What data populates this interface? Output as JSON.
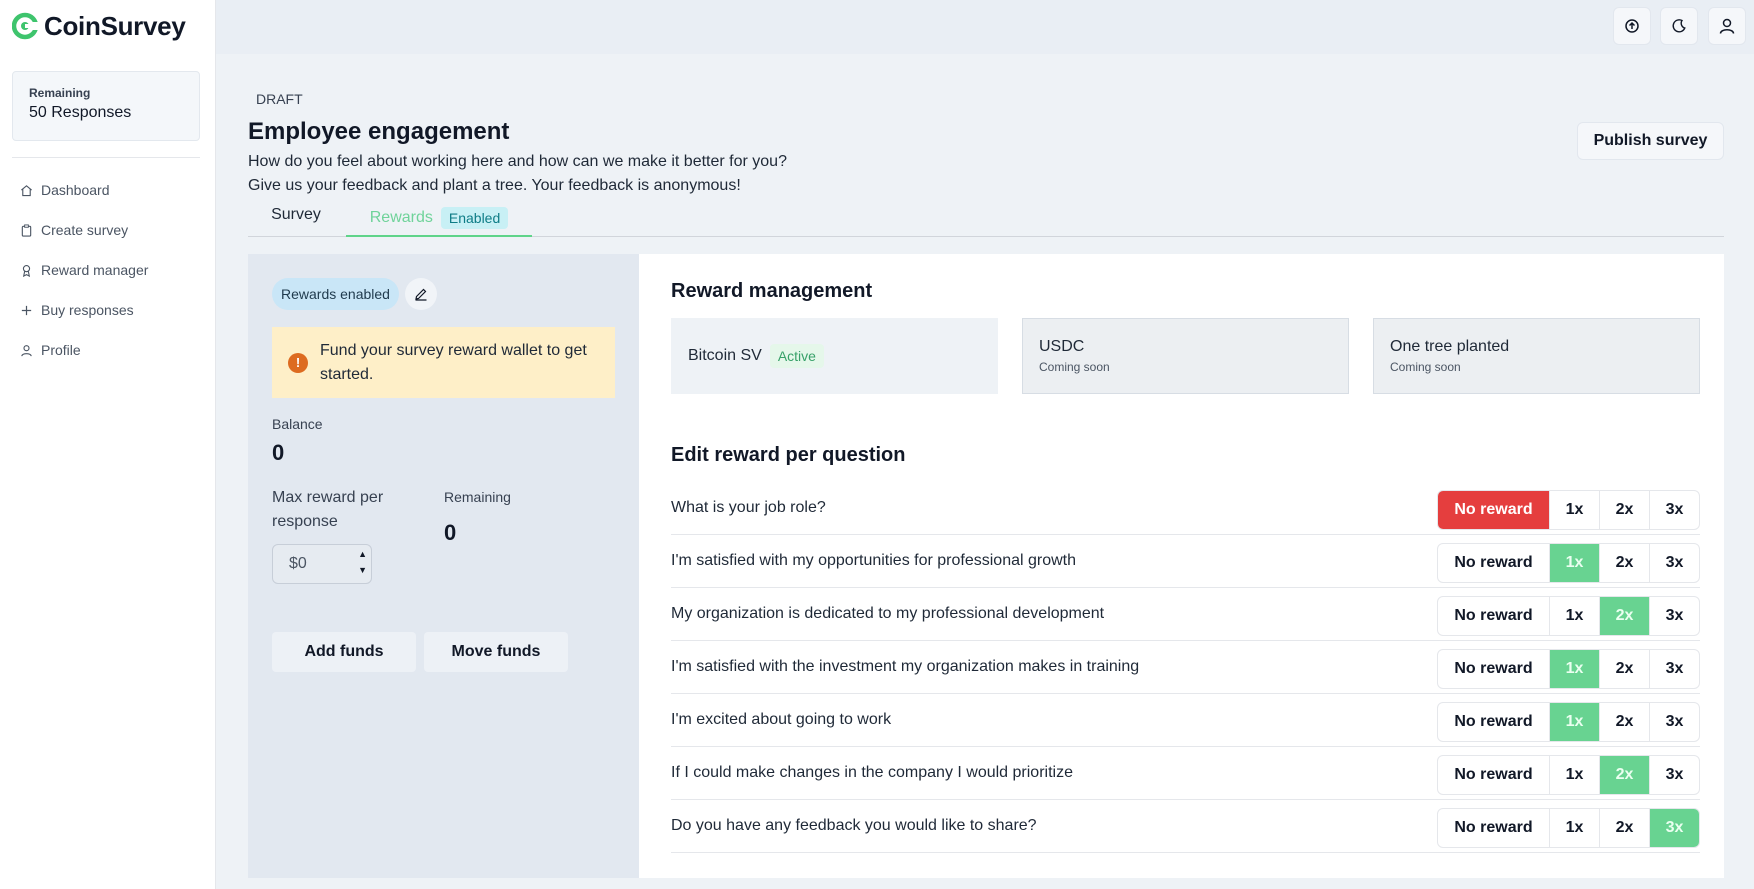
{
  "app": {
    "name": "CoinSurvey"
  },
  "sidebar": {
    "remaining_label": "Remaining",
    "remaining_value": "50 Responses",
    "items": [
      {
        "label": "Dashboard",
        "icon": "home-icon"
      },
      {
        "label": "Create survey",
        "icon": "clipboard-icon"
      },
      {
        "label": "Reward manager",
        "icon": "award-icon"
      },
      {
        "label": "Buy responses",
        "icon": "plus-icon"
      },
      {
        "label": "Profile",
        "icon": "user-icon"
      }
    ]
  },
  "topbar": {
    "icons": [
      "upload-icon",
      "moon-icon",
      "user-icon"
    ]
  },
  "header": {
    "status": "DRAFT",
    "title": "Employee engagement",
    "subtitle_line1": "How do you feel about working here and how can we make it better for you?",
    "subtitle_line2": "Give us your feedback and plant a tree. Your feedback is anonymous!",
    "publish_label": "Publish survey"
  },
  "tabs": {
    "survey": "Survey",
    "rewards": "Rewards",
    "rewards_badge": "Enabled"
  },
  "wallet": {
    "pill": "Rewards enabled",
    "alert": "Fund your survey reward wallet to get started.",
    "balance_label": "Balance",
    "balance_value": "0",
    "max_label": "Max reward per response",
    "max_value": "$0",
    "remaining_label": "Remaining",
    "remaining_value": "0",
    "add_funds": "Add funds",
    "move_funds": "Move funds"
  },
  "reward_management": {
    "title": "Reward management",
    "coins": [
      {
        "name": "Bitcoin SV",
        "status": "Active"
      },
      {
        "name": "USDC",
        "status": "Coming soon"
      },
      {
        "name": "One tree planted",
        "status": "Coming soon"
      }
    ]
  },
  "questions": {
    "title": "Edit reward per question",
    "options": [
      "No reward",
      "1x",
      "2x",
      "3x"
    ],
    "items": [
      {
        "text": "What is your job role?",
        "selected": "No reward"
      },
      {
        "text": "I'm satisfied with my opportunities for professional growth",
        "selected": "1x"
      },
      {
        "text": "My organization is dedicated to my professional development",
        "selected": "2x"
      },
      {
        "text": "I'm satisfied with the investment my organization makes in training",
        "selected": "1x"
      },
      {
        "text": "I'm excited about going to work",
        "selected": "1x"
      },
      {
        "text": "If I could make changes in the company I would prioritize",
        "selected": "2x"
      },
      {
        "text": "Do you have any feedback you would like to share?",
        "selected": "3x"
      }
    ]
  },
  "colors": {
    "accent": "#68d391",
    "danger": "#e53e3e",
    "warning_bg": "#feefc8"
  }
}
